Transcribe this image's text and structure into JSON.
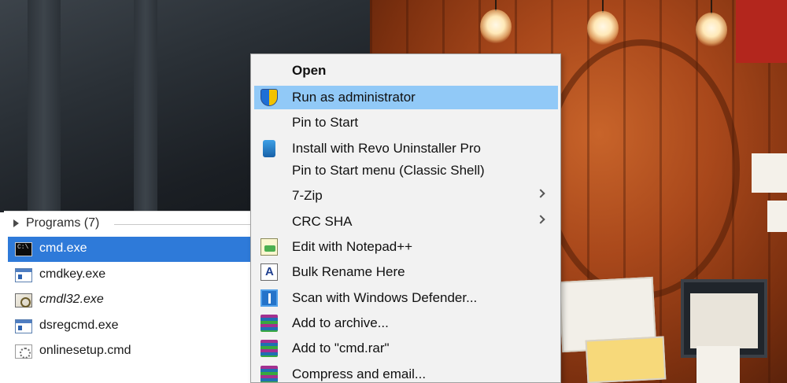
{
  "programs": {
    "header": "Programs (7)",
    "items": [
      {
        "label": "cmd.exe",
        "icon": "cmd-icon",
        "selected": true
      },
      {
        "label": "cmdkey.exe",
        "icon": "app-icon",
        "selected": false
      },
      {
        "label": "cmdl32.exe",
        "icon": "script-icon",
        "selected": false
      },
      {
        "label": "dsregcmd.exe",
        "icon": "app-icon",
        "selected": false
      },
      {
        "label": "onlinesetup.cmd",
        "icon": "gear-icon",
        "selected": false
      }
    ]
  },
  "context_menu": {
    "items": [
      {
        "label": "Open",
        "bold": true,
        "icon": null
      },
      {
        "label": "Run as administrator",
        "highlighted": true,
        "icon": "shield-icon"
      },
      {
        "label": "Pin to Start",
        "icon": null
      },
      {
        "label": "Install with Revo Uninstaller Pro",
        "icon": "revo-icon"
      },
      {
        "label": "Pin to Start menu (Classic Shell)",
        "icon": null
      },
      {
        "label": "7-Zip",
        "submenu": true,
        "icon": null
      },
      {
        "label": "CRC SHA",
        "submenu": true,
        "icon": null
      },
      {
        "label": "Edit with Notepad++",
        "icon": "notepad-icon"
      },
      {
        "label": "Bulk Rename Here",
        "icon": "bulk-rename-icon"
      },
      {
        "label": "Scan with Windows Defender...",
        "icon": "defender-icon"
      },
      {
        "label": "Add to archive...",
        "icon": "winrar-icon"
      },
      {
        "label": "Add to \"cmd.rar\"",
        "icon": "winrar-icon"
      },
      {
        "label": "Compress and email...",
        "icon": "winrar-icon"
      }
    ]
  },
  "colors": {
    "selection_blue": "#2e7ad9",
    "menu_highlight": "#91c9f7",
    "menu_background": "#f2f2f2"
  }
}
